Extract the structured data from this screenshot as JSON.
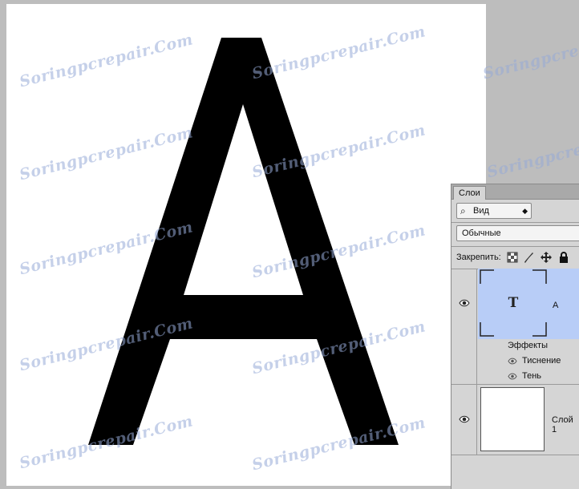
{
  "canvas": {
    "letter": "A",
    "watermark_text": "Soringpcrepair.Com"
  },
  "layers_panel": {
    "tab_label": "Слои",
    "filter": {
      "search_icon": "search-icon",
      "label": "Вид"
    },
    "blend_mode": "Обычные",
    "lock_label": "Закрепить:",
    "lock_icons": [
      "lock-transparent-pixels-icon",
      "lock-image-pixels-icon",
      "lock-position-icon",
      "lock-all-icon"
    ],
    "layers": [
      {
        "name": "A",
        "type": "text",
        "thumb_glyph": "T",
        "selected": true,
        "effects_label": "Эффекты",
        "effects": [
          "Тиснение",
          "Тень"
        ]
      },
      {
        "name": "Слой 1",
        "type": "raster",
        "selected": false
      }
    ]
  },
  "colors": {
    "workspace": "#bdbdbd",
    "canvas": "#ffffff",
    "selected_layer": "#b8cdf7",
    "panel_bg": "#d5d5d5"
  }
}
